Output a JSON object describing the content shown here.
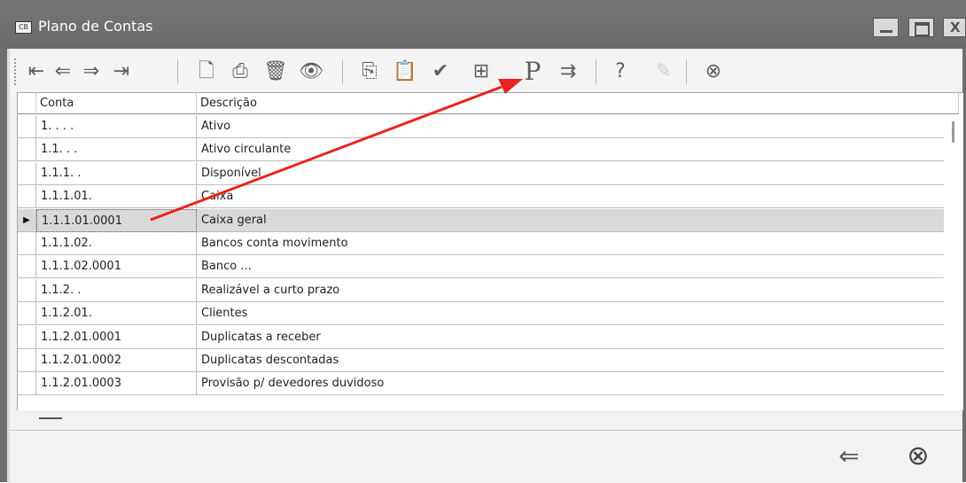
{
  "window": {
    "title": "Plano de Contas",
    "app_icon": "CB"
  },
  "titlebar_buttons": {
    "close": "X"
  },
  "toolbar": [
    {
      "name": "first-record-icon",
      "glyph": "⇤"
    },
    {
      "name": "prev-record-icon",
      "glyph": "⇐"
    },
    {
      "name": "next-record-icon",
      "glyph": "⇒"
    },
    {
      "name": "last-record-icon",
      "glyph": "⇥"
    },
    {
      "name": "new-document-icon",
      "glyph": "🗋"
    },
    {
      "name": "print-icon",
      "glyph": "⎙"
    },
    {
      "name": "delete-icon",
      "glyph": "🗑"
    },
    {
      "name": "view-icon",
      "glyph": "👁"
    },
    {
      "name": "copy-icon",
      "glyph": "⎘"
    },
    {
      "name": "paste-icon",
      "glyph": "📋"
    },
    {
      "name": "confirm-icon",
      "glyph": "✔"
    },
    {
      "name": "tree-chart-icon",
      "glyph": "⊞"
    },
    {
      "name": "p-icon",
      "glyph": "P"
    },
    {
      "name": "filter-icon",
      "glyph": "⇉"
    },
    {
      "name": "help-icon",
      "glyph": "?"
    },
    {
      "name": "edit-disabled-icon",
      "glyph": "✎"
    },
    {
      "name": "close-circle-icon",
      "glyph": "⊗"
    }
  ],
  "grid": {
    "columns": {
      "conta": "Conta",
      "descricao": "Descrição"
    },
    "rows": [
      {
        "conta": "1. . . .",
        "descricao": "Ativo"
      },
      {
        "conta": "1.1. . .",
        "descricao": "Ativo circulante"
      },
      {
        "conta": "1.1.1. .",
        "descricao": "Disponível"
      },
      {
        "conta": "1.1.1.01.",
        "descricao": "Caixa"
      },
      {
        "conta": "1.1.1.01.0001",
        "descricao": "Caixa geral"
      },
      {
        "conta": "1.1.1.02.",
        "descricao": "Bancos conta movimento"
      },
      {
        "conta": "1.1.1.02.0001",
        "descricao": "Banco ..."
      },
      {
        "conta": "1.1.2. .",
        "descricao": "Realizável a curto prazo"
      },
      {
        "conta": "1.1.2.01.",
        "descricao": "Clientes"
      },
      {
        "conta": "1.1.2.01.0001",
        "descricao": "Duplicatas a receber"
      },
      {
        "conta": "1.1.2.01.0002",
        "descricao": "Duplicatas descontadas"
      },
      {
        "conta": "1.1.2.01.0003",
        "descricao": "Provisão p/ devedores duvidoso"
      }
    ],
    "selected_row_index": 4
  },
  "bottom": {
    "back_glyph": "⇐",
    "close_glyph": "⊗"
  },
  "colors": {
    "annotation_arrow": "#e8231f",
    "selected_row": "#d9d9d9",
    "titlebar": "#6e6e6e"
  }
}
